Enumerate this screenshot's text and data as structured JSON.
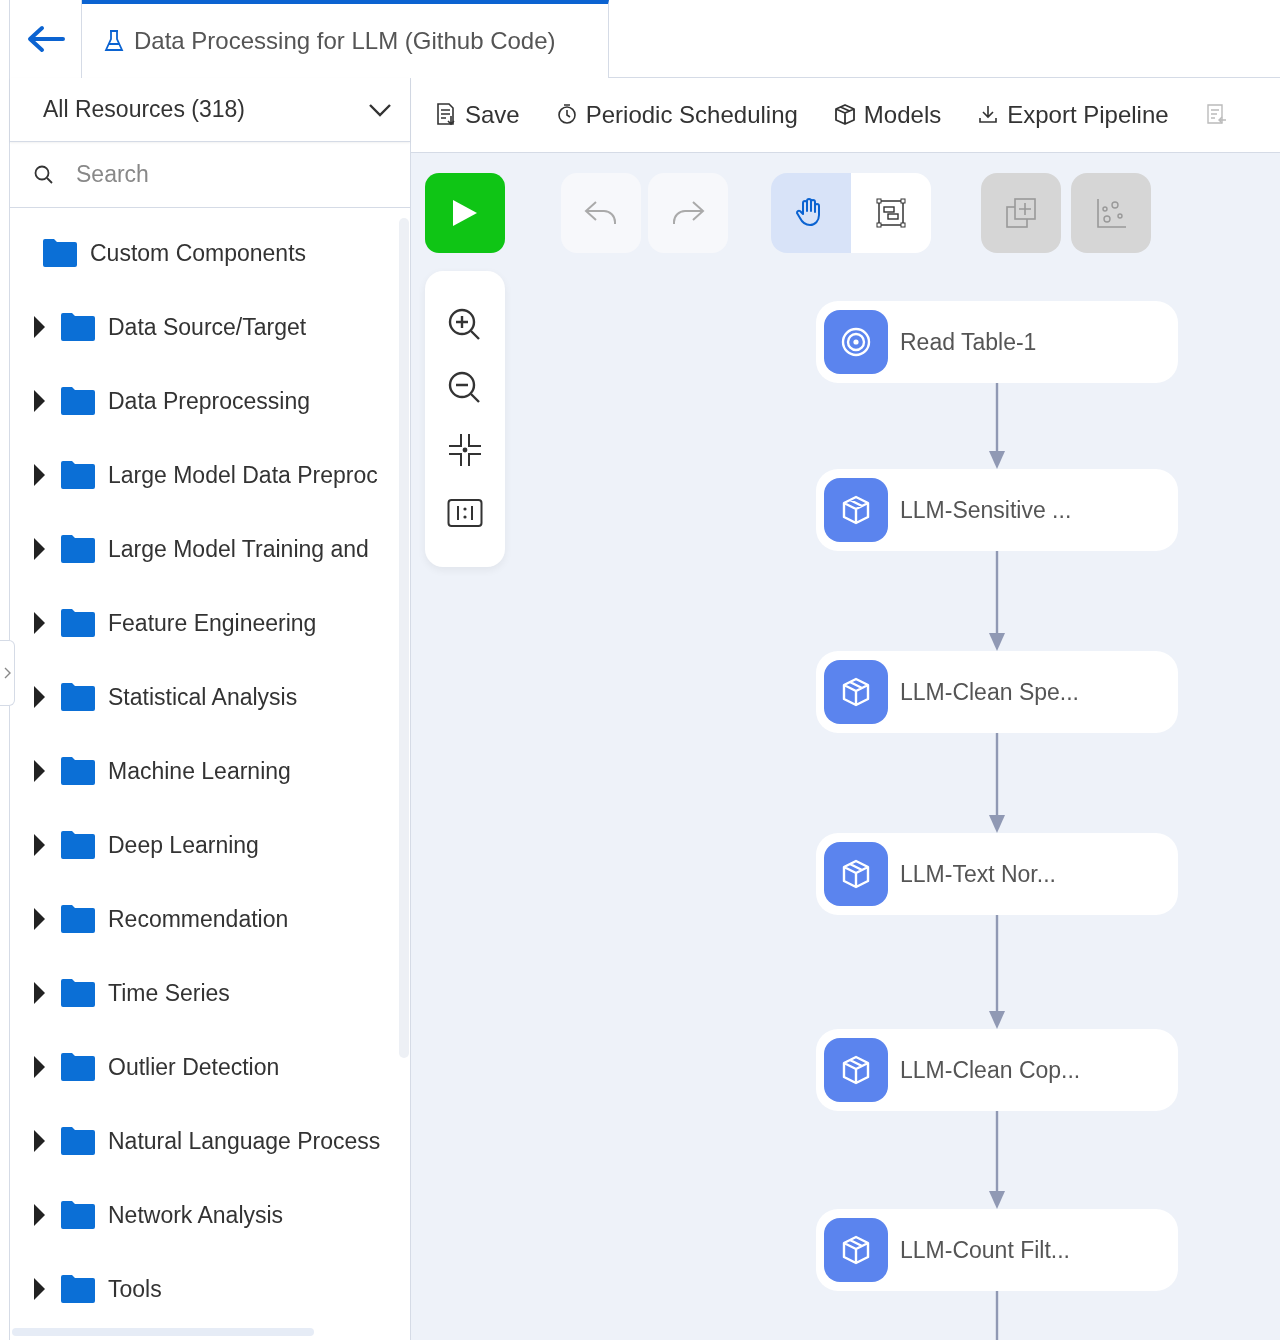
{
  "header": {
    "tab_title": "Data Processing for LLM (Github Code)",
    "tab_selected": true
  },
  "sidebar": {
    "resource_filter": "All Resources (318)",
    "search": {
      "placeholder": "Search"
    },
    "items": [
      {
        "label": "Custom Components",
        "kind": "plain"
      },
      {
        "label": "Data Source/Target",
        "kind": "group",
        "expanded": false
      },
      {
        "label": "Data Preprocessing",
        "kind": "group",
        "expanded": false
      },
      {
        "label": "Large Model Data Preproc",
        "kind": "group",
        "expanded": false
      },
      {
        "label": "Large Model Training and",
        "kind": "group",
        "expanded": false
      },
      {
        "label": "Feature Engineering",
        "kind": "group",
        "expanded": false
      },
      {
        "label": "Statistical Analysis",
        "kind": "group",
        "expanded": false
      },
      {
        "label": "Machine Learning",
        "kind": "group",
        "expanded": false
      },
      {
        "label": "Deep Learning",
        "kind": "group",
        "expanded": false
      },
      {
        "label": "Recommendation",
        "kind": "group",
        "expanded": false
      },
      {
        "label": "Time Series",
        "kind": "group",
        "expanded": false
      },
      {
        "label": "Outlier Detection",
        "kind": "group",
        "expanded": false
      },
      {
        "label": "Natural Language Process",
        "kind": "group",
        "expanded": false
      },
      {
        "label": "Network Analysis",
        "kind": "group",
        "expanded": false
      },
      {
        "label": "Tools",
        "kind": "group",
        "expanded": false
      }
    ]
  },
  "toolbar": [
    {
      "label": "Save",
      "kind": "save",
      "disabled": false
    },
    {
      "label": "Periodic Scheduling",
      "kind": "clock",
      "disabled": false
    },
    {
      "label": "Models",
      "kind": "cube",
      "disabled": false
    },
    {
      "label": "Export Pipeline",
      "kind": "download",
      "disabled": false
    },
    {
      "kind": "report",
      "disabled": true
    }
  ],
  "canvas_tools": {
    "undo_disabled": true,
    "redo_disabled": true,
    "mode": [
      {
        "kind": "hand",
        "selected": true
      },
      {
        "kind": "select",
        "selected": false
      }
    ],
    "extra_disabled": true
  },
  "nodes": [
    {
      "label": "Read Table-1",
      "kind": "source"
    },
    {
      "label": "LLM-Sensitive ...",
      "kind": "component"
    },
    {
      "label": "LLM-Clean Spe...",
      "kind": "component"
    },
    {
      "label": "LLM-Text Nor...",
      "kind": "component"
    },
    {
      "label": "LLM-Clean Cop...",
      "kind": "component"
    },
    {
      "label": "LLM-Count Filt...",
      "kind": "component"
    }
  ]
}
